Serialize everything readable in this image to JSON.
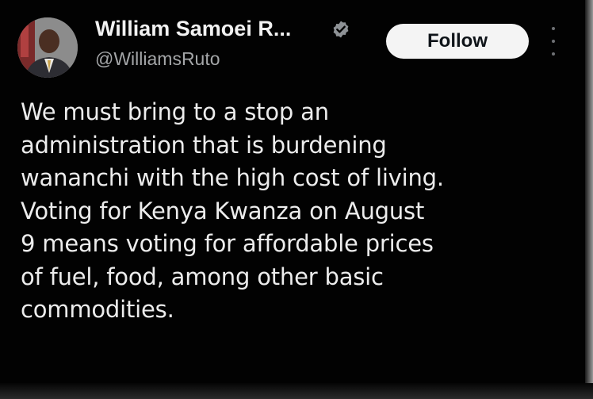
{
  "tweet": {
    "author": {
      "display_name": "William Samoei R...",
      "handle": "@WilliamsRuto",
      "verified": true,
      "avatar_icon": "profile-photo"
    },
    "follow_label": "Follow",
    "more_icon": "vertical-ellipsis-icon",
    "text_lines": [
      "We must bring to a stop an",
      "administration that is burdening",
      "wananchi with the high cost of living.",
      "Voting for Kenya Kwanza on August",
      "9 means voting for affordable prices",
      "of fuel, food, among other basic",
      "commodities."
    ]
  },
  "colors": {
    "background": "#020202",
    "text": "#ececec",
    "handle": "#a4a6a8",
    "verified_badge": "#8e9296",
    "follow_button": "#f4f4f4"
  }
}
